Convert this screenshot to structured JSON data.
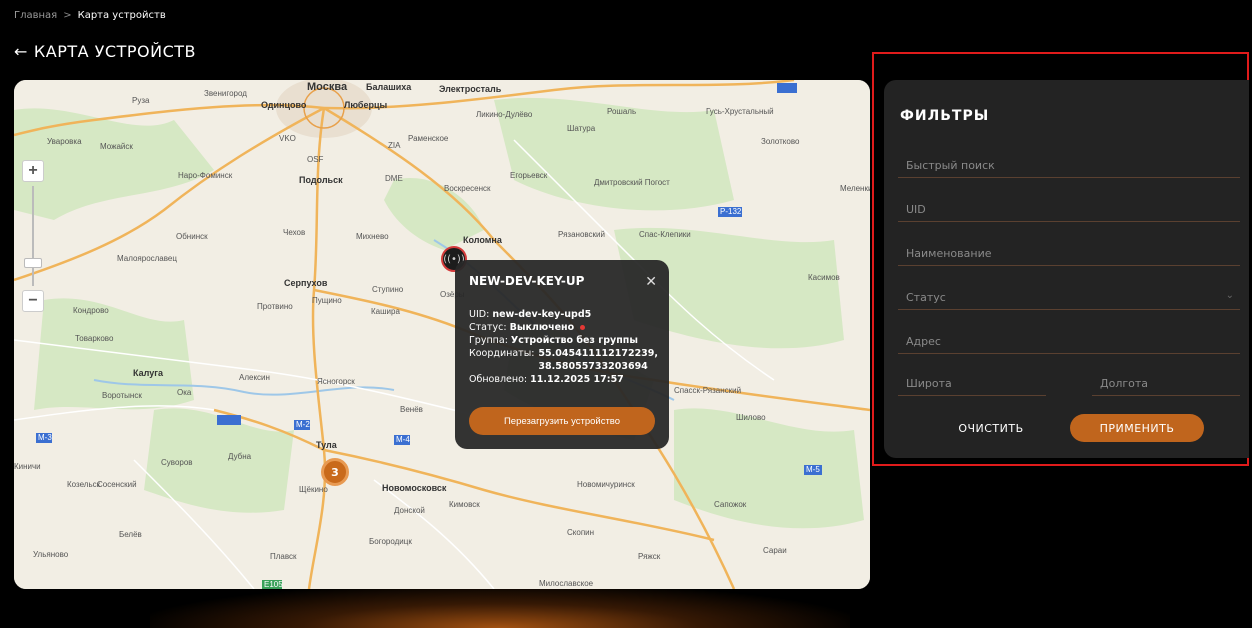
{
  "breadcrumb": {
    "home": "Главная",
    "separator": ">",
    "current": "Карта устройств"
  },
  "page": {
    "back_icon": "←",
    "title": "КАРТА УСТРОЙСТВ"
  },
  "map": {
    "labels": [
      "Москва",
      "Балашиха",
      "Электросталь",
      "Звенигород",
      "Руза",
      "Одинцово",
      "Люберцы",
      "Ликино-Дулёво",
      "Рошаль",
      "Гусь-Хрустальный",
      "Уваровка",
      "Можайск",
      "VKO",
      "Раменское",
      "Шатура",
      "Золотково",
      "Наро-Фоминск",
      "OSF",
      "Подольск",
      "ZIA",
      "DME",
      "Егорьевск",
      "Воскресенск",
      "Дмитровский Погост",
      "Меленки",
      "Р-132",
      "Обнинск",
      "Чехов",
      "Михнево",
      "Коломна",
      "Рязановский",
      "Спас-Клепики",
      "Малоярославец",
      "Серпухов",
      "Ступино",
      "Пущино",
      "Протвино",
      "Кашира",
      "Озёры",
      "Касимов",
      "Кондрово",
      "Товарково",
      "Калуга",
      "Алексин",
      "Ясногорск",
      "Воротынск",
      "Ока",
      "Спасск-Рязанский",
      "Венёв",
      "Шилово",
      "Тула",
      "М-2",
      "М-4",
      "Суворов",
      "Дубна",
      "Козельск",
      "Сосенский",
      "Щёкино",
      "Новомосковск",
      "Кимовск",
      "Донской",
      "Новомичуринск",
      "Сапожок",
      "М-5",
      "Белёв",
      "Богородицк",
      "Скопин",
      "Ульяново",
      "Плавск",
      "Ряжск",
      "Сараи",
      "Милославское",
      "Е105",
      "М-3",
      "Киничи"
    ],
    "zoom_in": "+",
    "zoom_out": "−",
    "cluster_count": "3",
    "device_marker_icon": "signal-icon"
  },
  "popup": {
    "title": "NEW-DEV-KEY-UP",
    "close": "✕",
    "uid_label": "UID:",
    "uid_value": "new-dev-key-upd5",
    "status_label": "Статус:",
    "status_value": "Выключено",
    "group_label": "Группа:",
    "group_value": "Устройство без группы",
    "coords_label": "Координаты:",
    "coords_lat": "55.045411112172239,",
    "coords_lon": "38.58055733203694",
    "updated_label": "Обновлено:",
    "updated_value": "11.12.2025 17:57",
    "reboot_button": "Перезагрузить устройство"
  },
  "filters": {
    "title": "ФИЛЬТРЫ",
    "quick_search": "Быстрый поиск",
    "uid": "UID",
    "name": "Наименование",
    "status": "Статус",
    "address": "Адрес",
    "latitude": "Широта",
    "longitude": "Долгота",
    "clear_button": "ОЧИСТИТЬ",
    "apply_button": "ПРИМЕНИТЬ"
  },
  "colors": {
    "accent": "#c0651d",
    "highlight": "#e01b1b",
    "panel": "#232323",
    "status_off": "#e53935"
  }
}
